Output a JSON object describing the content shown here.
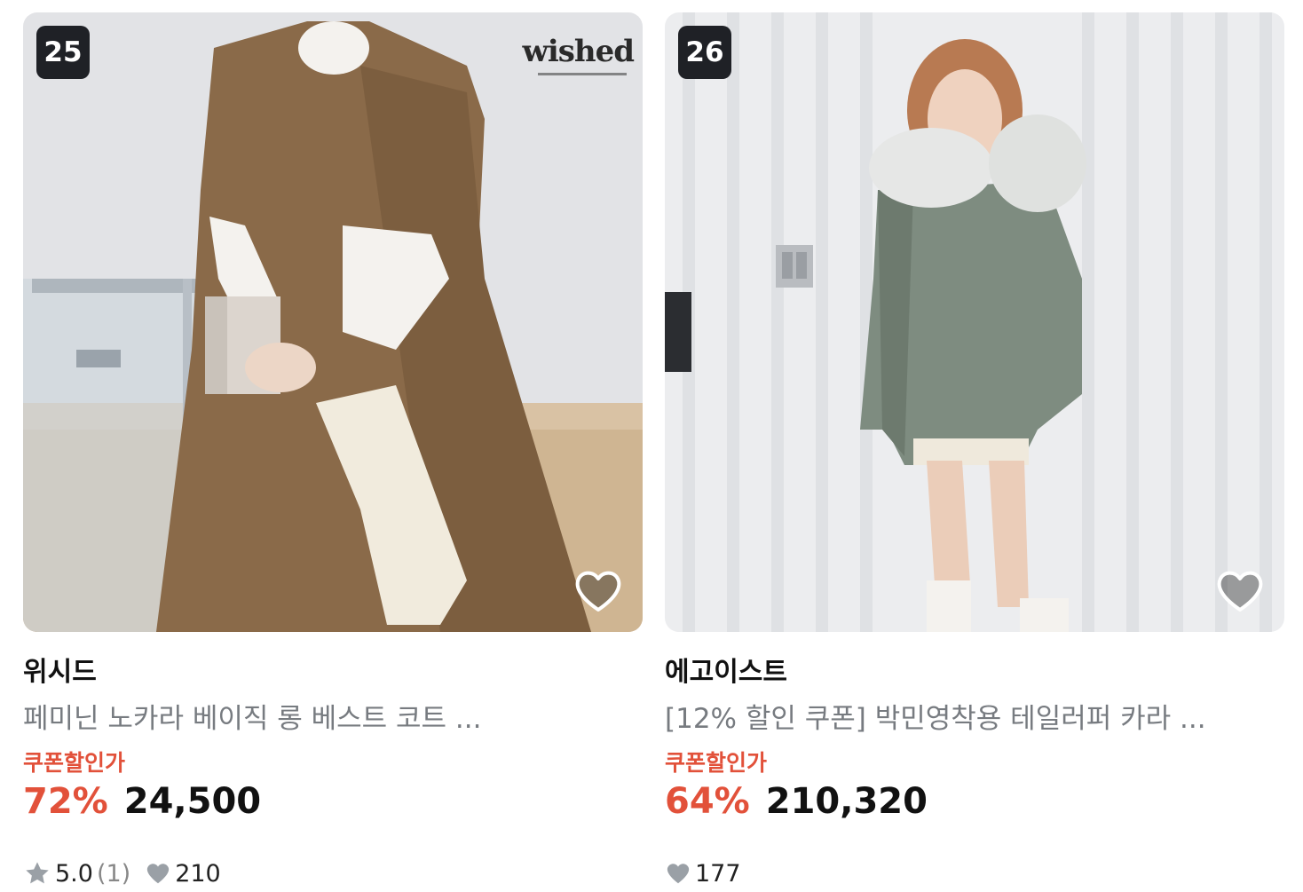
{
  "products": [
    {
      "rank": "25",
      "logo_text": "wished",
      "brand": "위시드",
      "title": "페미닌 노카라 베이직 롱 베스트 코트 ...",
      "coupon_label": "쿠폰할인가",
      "discount": "72%",
      "price": "24,500",
      "rating": "5.0",
      "review_count": "(1)",
      "likes": "210"
    },
    {
      "rank": "26",
      "brand": "에고이스트",
      "title": "[12% 할인 쿠폰] 박민영착용 테일러퍼 카라 ...",
      "coupon_label": "쿠폰할인가",
      "discount": "64%",
      "price": "210,320",
      "likes": "177"
    }
  ],
  "colors": {
    "accent_red": "#e2513a",
    "rank_badge": "#1f2126",
    "muted_text": "#777b80",
    "icon_gray": "#9aa0a6"
  },
  "icons": [
    "heart-outline-icon",
    "star-icon",
    "heart-filled-icon"
  ]
}
